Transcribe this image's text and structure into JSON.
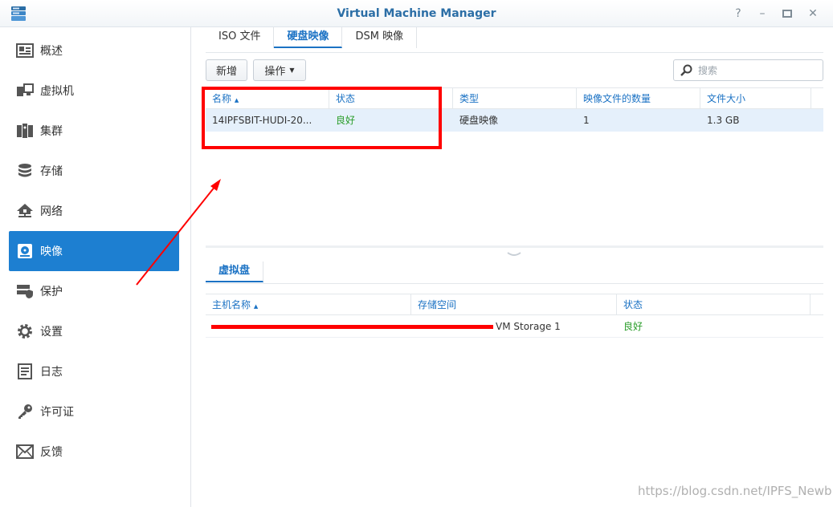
{
  "window": {
    "title": "Virtual Machine Manager"
  },
  "sidebar": {
    "items": [
      {
        "label": "概述",
        "icon": "overview-icon"
      },
      {
        "label": "虚拟机",
        "icon": "virtual-machine-icon"
      },
      {
        "label": "集群",
        "icon": "cluster-icon"
      },
      {
        "label": "存储",
        "icon": "storage-icon"
      },
      {
        "label": "网络",
        "icon": "network-icon"
      },
      {
        "label": "映像",
        "icon": "image-icon"
      },
      {
        "label": "保护",
        "icon": "protection-icon"
      },
      {
        "label": "设置",
        "icon": "settings-icon"
      },
      {
        "label": "日志",
        "icon": "log-icon"
      },
      {
        "label": "许可证",
        "icon": "license-key-icon"
      },
      {
        "label": "反馈",
        "icon": "feedback-mail-icon"
      }
    ],
    "active": "映像",
    "accent_color": "#1d7fd1"
  },
  "tabs": [
    "ISO 文件",
    "硬盘映像",
    "DSM 映像"
  ],
  "active_tab": "硬盘映像",
  "toolbar": {
    "add_label": "新增",
    "action_label": "操作",
    "search_placeholder": "搜索"
  },
  "disk_images": {
    "columns": [
      "名称",
      "状态",
      "类型",
      "映像文件的数量",
      "文件大小"
    ],
    "rows": [
      {
        "name": "14IPFSBIT-HUDI-20...",
        "status": "良好",
        "type": "硬盘映像",
        "count": "1",
        "size": "1.3 GB"
      }
    ]
  },
  "lower_tab": "虚拟盘",
  "virtual_disks": {
    "columns": [
      "主机名称",
      "存储空间",
      "状态"
    ],
    "rows": [
      {
        "host": "",
        "storage": "VM Storage 1",
        "status": "良好"
      }
    ]
  },
  "watermark": "https://blog.csdn.net/IPFS_Newb",
  "status_good_color": "#2a9d2a"
}
